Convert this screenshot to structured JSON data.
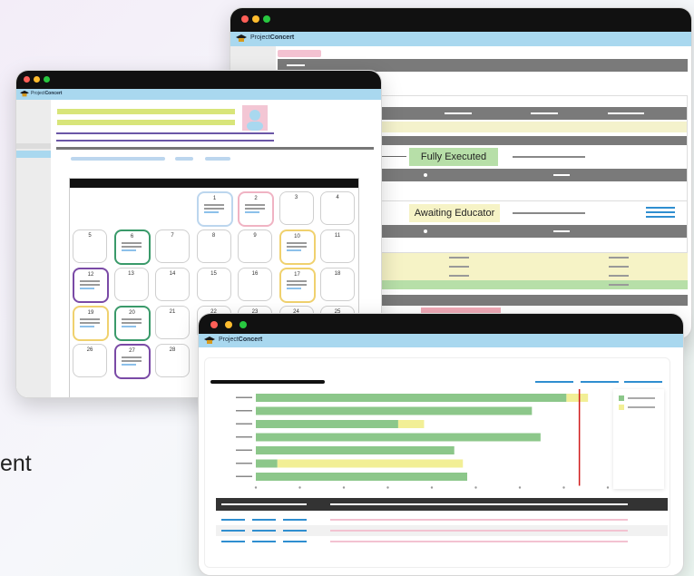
{
  "brand": {
    "prefix": "Project",
    "suffix": "Concert"
  },
  "contract_window": {
    "status_fully_executed": "Fully Executed",
    "status_awaiting": "Awaiting Educator"
  },
  "calendar": {
    "days": [
      "1",
      "2",
      "3",
      "4",
      "5",
      "6",
      "7",
      "8",
      "9",
      "10",
      "11",
      "12",
      "13",
      "14",
      "15",
      "16",
      "17",
      "18",
      "19",
      "20",
      "21",
      "22",
      "23",
      "24",
      "25",
      "26",
      "27",
      "28"
    ]
  },
  "footer_fragment": "ent",
  "colors": {
    "green": "#8cc78a",
    "yellow": "#f2ef96",
    "appbar": "#a9d8ef",
    "titlebar": "#111111",
    "red_marker": "#d11a1a",
    "blue_link": "#2f8ed0"
  },
  "chart_data": {
    "type": "bar",
    "orientation": "horizontal",
    "stacked": true,
    "categories": [
      "",
      "",
      "",
      "",
      "",
      "",
      ""
    ],
    "series": [
      {
        "values": [
          72,
          64,
          33,
          66,
          46,
          5,
          49
        ]
      },
      {
        "values": [
          5,
          0,
          6,
          0,
          0,
          43,
          0
        ]
      }
    ],
    "xlim": [
      0,
      94
    ],
    "marker_x": 75,
    "grid": false,
    "legend": "right"
  }
}
